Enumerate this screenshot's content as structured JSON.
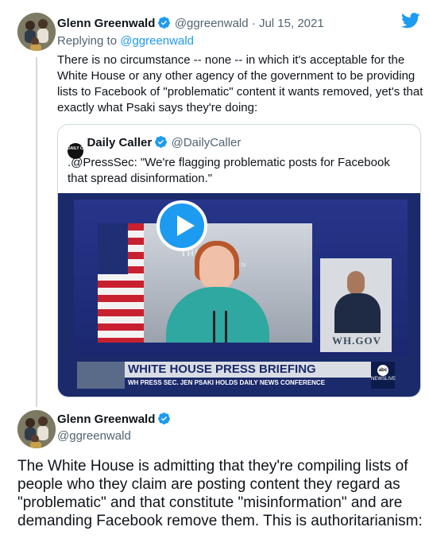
{
  "tweet1": {
    "author_name": "Glenn Greenwald",
    "author_handle": "@ggreenwald",
    "separator": " · ",
    "date": "Jul 15, 2021",
    "replying_prefix": "Replying to ",
    "replying_handle": "@ggreenwald",
    "text": "There is no circumstance -- none -- in which it's acceptable for the White House or any other agency of the government to be providing lists to Facebook of \"problematic\" content it wants removed, yet's that exactly what Psaki says they're doing:"
  },
  "quote": {
    "author_name": "Daily Caller",
    "author_handle": "@DailyCaller",
    "logo_text": "DAILY CALLER",
    "text": ".@PressSec: \"We're flagging problematic posts for Facebook that spread disinformation.\"",
    "video": {
      "wall_text": "THE WHITE",
      "wall_text2": "WASHIN",
      "wh_gov": "WH.GOV",
      "banner_title": "WHITE HOUSE PRESS BRIEFING",
      "banner_subtitle": "WH PRESS SEC. JEN PSAKI HOLDS DAILY NEWS CONFERENCE",
      "network_logo": "abc",
      "network_label": "NEWSLIVE"
    }
  },
  "tweet2": {
    "author_name": "Glenn Greenwald",
    "author_handle": "@ggreenwald",
    "text": "The White House is admitting that they're compiling lists of people who they claim are posting content they regard as \"problematic\" and that constitute \"misinformation\" and are demanding Facebook remove them. This is authoritarianism:"
  },
  "icons": {
    "verified": "verified-badge-icon",
    "platform": "twitter-bird-icon",
    "play": "play-icon"
  },
  "colors": {
    "accent": "#1d9bf0",
    "text": "#0f1419",
    "muted": "#536471",
    "border": "#cfd9de"
  }
}
